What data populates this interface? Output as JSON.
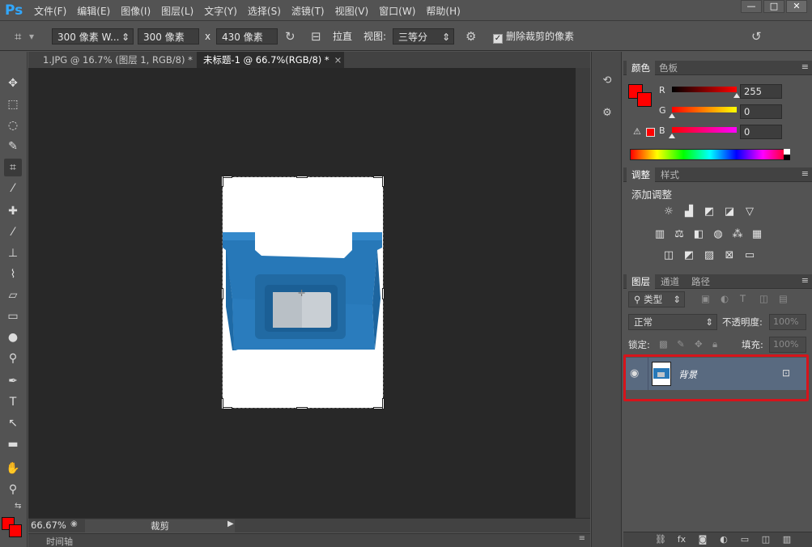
{
  "app": {
    "logo": "Ps",
    "menu": [
      "文件(F)",
      "编辑(E)",
      "图像(I)",
      "图层(L)",
      "文字(Y)",
      "选择(S)",
      "滤镜(T)",
      "视图(V)",
      "窗口(W)",
      "帮助(H)"
    ],
    "window_controls": {
      "minimize": "—",
      "maximize": "□",
      "close": "✕"
    }
  },
  "options_bar": {
    "preset": "300 像素 W...",
    "width": "300 像素",
    "x_sep": "x",
    "height": "430 像素",
    "straighten": "拉直",
    "view_label": "视图:",
    "view_value": "三等分",
    "delete_cropped_label": "删除裁剪的像素",
    "delete_cropped_checked": true
  },
  "tabs": [
    {
      "label": "1.JPG @ 16.7% (图层 1, RGB/8) *",
      "close": "×",
      "active": false
    },
    {
      "label": "未标题-1 @ 66.7%(RGB/8) *",
      "close": "×",
      "active": true
    }
  ],
  "status": {
    "zoom": "66.67%",
    "info": "裁剪",
    "timeline": "时间轴"
  },
  "color_panel": {
    "tabs": [
      "颜色",
      "色板"
    ],
    "channels": [
      {
        "label": "R",
        "value": "255"
      },
      {
        "label": "G",
        "value": "0"
      },
      {
        "label": "B",
        "value": "0"
      }
    ],
    "foreground": "#ff0000",
    "background": "#ff0000"
  },
  "adjustments_panel": {
    "tabs": [
      "调整",
      "样式"
    ],
    "title": "添加调整"
  },
  "layers_panel": {
    "tabs": [
      "图层",
      "通道",
      "路径"
    ],
    "filter_kind": "类型",
    "blend_mode": "正常",
    "opacity_label": "不透明度:",
    "opacity_value": "100%",
    "lock_label": "锁定:",
    "fill_label": "填充:",
    "fill_value": "100%",
    "layers": [
      {
        "name": "背景",
        "locked": true,
        "visible": true
      }
    ],
    "highlight_color": "#d6141b"
  },
  "colors": {
    "accent_red": "#ff0000",
    "canvas_bg": "#282828",
    "ui_bg": "#535353"
  }
}
